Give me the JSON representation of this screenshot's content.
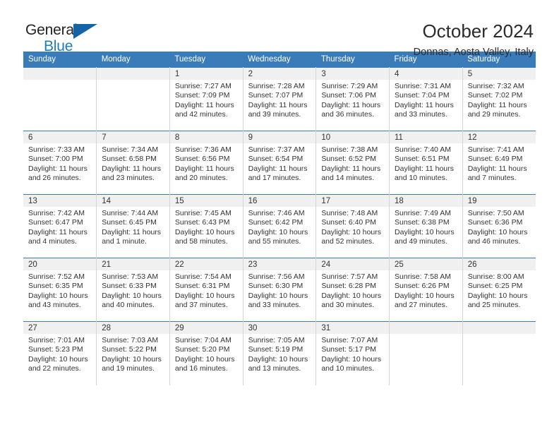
{
  "logo": {
    "word_top": "General",
    "word_bottom": "Blue",
    "triangle_color": "#1464a5",
    "blue_color": "#1c7cc0",
    "icon": "general-blue-logo"
  },
  "header": {
    "title": "October 2024",
    "subtitle": "Donnas, Aosta Valley, Italy"
  },
  "colors": {
    "header_blue": "#3a7cba",
    "daynum_band": "#f0f0f0",
    "text": "#333333",
    "cell_border": "#d4d4d4"
  },
  "weekday_headers": [
    "Sunday",
    "Monday",
    "Tuesday",
    "Wednesday",
    "Thursday",
    "Friday",
    "Saturday"
  ],
  "weeks": [
    [
      {
        "day": "",
        "lines": []
      },
      {
        "day": "",
        "lines": []
      },
      {
        "day": "1",
        "lines": [
          "Sunrise: 7:27 AM",
          "Sunset: 7:09 PM",
          "Daylight: 11 hours",
          "and 42 minutes."
        ]
      },
      {
        "day": "2",
        "lines": [
          "Sunrise: 7:28 AM",
          "Sunset: 7:07 PM",
          "Daylight: 11 hours",
          "and 39 minutes."
        ]
      },
      {
        "day": "3",
        "lines": [
          "Sunrise: 7:29 AM",
          "Sunset: 7:06 PM",
          "Daylight: 11 hours",
          "and 36 minutes."
        ]
      },
      {
        "day": "4",
        "lines": [
          "Sunrise: 7:31 AM",
          "Sunset: 7:04 PM",
          "Daylight: 11 hours",
          "and 33 minutes."
        ]
      },
      {
        "day": "5",
        "lines": [
          "Sunrise: 7:32 AM",
          "Sunset: 7:02 PM",
          "Daylight: 11 hours",
          "and 29 minutes."
        ]
      }
    ],
    [
      {
        "day": "6",
        "lines": [
          "Sunrise: 7:33 AM",
          "Sunset: 7:00 PM",
          "Daylight: 11 hours",
          "and 26 minutes."
        ]
      },
      {
        "day": "7",
        "lines": [
          "Sunrise: 7:34 AM",
          "Sunset: 6:58 PM",
          "Daylight: 11 hours",
          "and 23 minutes."
        ]
      },
      {
        "day": "8",
        "lines": [
          "Sunrise: 7:36 AM",
          "Sunset: 6:56 PM",
          "Daylight: 11 hours",
          "and 20 minutes."
        ]
      },
      {
        "day": "9",
        "lines": [
          "Sunrise: 7:37 AM",
          "Sunset: 6:54 PM",
          "Daylight: 11 hours",
          "and 17 minutes."
        ]
      },
      {
        "day": "10",
        "lines": [
          "Sunrise: 7:38 AM",
          "Sunset: 6:52 PM",
          "Daylight: 11 hours",
          "and 14 minutes."
        ]
      },
      {
        "day": "11",
        "lines": [
          "Sunrise: 7:40 AM",
          "Sunset: 6:51 PM",
          "Daylight: 11 hours",
          "and 10 minutes."
        ]
      },
      {
        "day": "12",
        "lines": [
          "Sunrise: 7:41 AM",
          "Sunset: 6:49 PM",
          "Daylight: 11 hours",
          "and 7 minutes."
        ]
      }
    ],
    [
      {
        "day": "13",
        "lines": [
          "Sunrise: 7:42 AM",
          "Sunset: 6:47 PM",
          "Daylight: 11 hours",
          "and 4 minutes."
        ]
      },
      {
        "day": "14",
        "lines": [
          "Sunrise: 7:44 AM",
          "Sunset: 6:45 PM",
          "Daylight: 11 hours",
          "and 1 minute."
        ]
      },
      {
        "day": "15",
        "lines": [
          "Sunrise: 7:45 AM",
          "Sunset: 6:43 PM",
          "Daylight: 10 hours",
          "and 58 minutes."
        ]
      },
      {
        "day": "16",
        "lines": [
          "Sunrise: 7:46 AM",
          "Sunset: 6:42 PM",
          "Daylight: 10 hours",
          "and 55 minutes."
        ]
      },
      {
        "day": "17",
        "lines": [
          "Sunrise: 7:48 AM",
          "Sunset: 6:40 PM",
          "Daylight: 10 hours",
          "and 52 minutes."
        ]
      },
      {
        "day": "18",
        "lines": [
          "Sunrise: 7:49 AM",
          "Sunset: 6:38 PM",
          "Daylight: 10 hours",
          "and 49 minutes."
        ]
      },
      {
        "day": "19",
        "lines": [
          "Sunrise: 7:50 AM",
          "Sunset: 6:36 PM",
          "Daylight: 10 hours",
          "and 46 minutes."
        ]
      }
    ],
    [
      {
        "day": "20",
        "lines": [
          "Sunrise: 7:52 AM",
          "Sunset: 6:35 PM",
          "Daylight: 10 hours",
          "and 43 minutes."
        ]
      },
      {
        "day": "21",
        "lines": [
          "Sunrise: 7:53 AM",
          "Sunset: 6:33 PM",
          "Daylight: 10 hours",
          "and 40 minutes."
        ]
      },
      {
        "day": "22",
        "lines": [
          "Sunrise: 7:54 AM",
          "Sunset: 6:31 PM",
          "Daylight: 10 hours",
          "and 37 minutes."
        ]
      },
      {
        "day": "23",
        "lines": [
          "Sunrise: 7:56 AM",
          "Sunset: 6:30 PM",
          "Daylight: 10 hours",
          "and 33 minutes."
        ]
      },
      {
        "day": "24",
        "lines": [
          "Sunrise: 7:57 AM",
          "Sunset: 6:28 PM",
          "Daylight: 10 hours",
          "and 30 minutes."
        ]
      },
      {
        "day": "25",
        "lines": [
          "Sunrise: 7:58 AM",
          "Sunset: 6:26 PM",
          "Daylight: 10 hours",
          "and 27 minutes."
        ]
      },
      {
        "day": "26",
        "lines": [
          "Sunrise: 8:00 AM",
          "Sunset: 6:25 PM",
          "Daylight: 10 hours",
          "and 25 minutes."
        ]
      }
    ],
    [
      {
        "day": "27",
        "lines": [
          "Sunrise: 7:01 AM",
          "Sunset: 5:23 PM",
          "Daylight: 10 hours",
          "and 22 minutes."
        ]
      },
      {
        "day": "28",
        "lines": [
          "Sunrise: 7:03 AM",
          "Sunset: 5:22 PM",
          "Daylight: 10 hours",
          "and 19 minutes."
        ]
      },
      {
        "day": "29",
        "lines": [
          "Sunrise: 7:04 AM",
          "Sunset: 5:20 PM",
          "Daylight: 10 hours",
          "and 16 minutes."
        ]
      },
      {
        "day": "30",
        "lines": [
          "Sunrise: 7:05 AM",
          "Sunset: 5:19 PM",
          "Daylight: 10 hours",
          "and 13 minutes."
        ]
      },
      {
        "day": "31",
        "lines": [
          "Sunrise: 7:07 AM",
          "Sunset: 5:17 PM",
          "Daylight: 10 hours",
          "and 10 minutes."
        ]
      },
      {
        "day": "",
        "lines": []
      },
      {
        "day": "",
        "lines": []
      }
    ]
  ]
}
